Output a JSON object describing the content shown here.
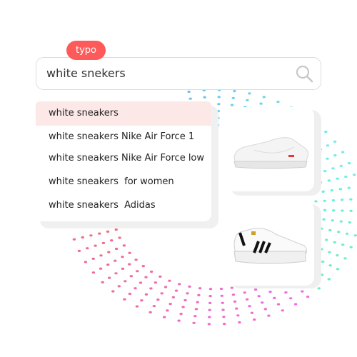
{
  "badge": {
    "label": "typo",
    "color": "#ff5a5a"
  },
  "search": {
    "value": "white snekers",
    "icon": "search-icon"
  },
  "suggestions": [
    {
      "label": "white sneakers",
      "highlighted": true
    },
    {
      "label": "white sneakers Nike Air Force 1",
      "highlighted": false
    },
    {
      "label": "white sneakers Nike Air Force low",
      "highlighted": false
    },
    {
      "label": "white sneakers  for women",
      "highlighted": false
    },
    {
      "label": "white sneakers  Adidas",
      "highlighted": false
    }
  ],
  "products": [
    {
      "image": "white-nike-air-force-1-sneaker"
    },
    {
      "image": "white-adidas-superstar-sneaker"
    }
  ],
  "colors": {
    "highlight": "#fde8e8",
    "accent": "#ff5a5a"
  }
}
